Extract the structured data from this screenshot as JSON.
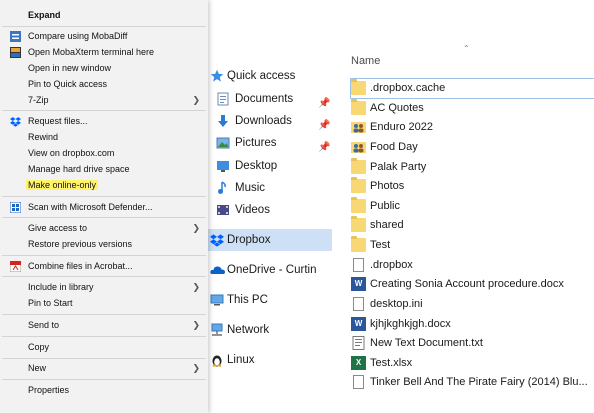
{
  "context_menu": {
    "items": [
      {
        "label": "Expand",
        "icon": "",
        "submenu": false
      },
      {
        "label": "Compare using MobaDiff",
        "icon": "mobadiff-icon",
        "submenu": false
      },
      {
        "label": "Open MobaXterm terminal here",
        "icon": "mobaxterm-icon",
        "submenu": false
      },
      {
        "label": "Open in new window",
        "icon": "",
        "submenu": false
      },
      {
        "label": "Pin to Quick access",
        "icon": "",
        "submenu": false
      },
      {
        "label": "7-Zip",
        "icon": "",
        "submenu": true
      },
      {
        "label": "Request files...",
        "icon": "dropbox-icon",
        "submenu": false
      },
      {
        "label": "Rewind",
        "icon": "",
        "submenu": false
      },
      {
        "label": "View on dropbox.com",
        "icon": "",
        "submenu": false
      },
      {
        "label": "Manage hard drive space",
        "icon": "",
        "submenu": false
      },
      {
        "label": "Make online-only",
        "icon": "",
        "submenu": false,
        "highlight_color": "#fff36b"
      },
      {
        "label": "Scan with Microsoft Defender...",
        "icon": "defender-icon",
        "submenu": false
      },
      {
        "label": "Give access to",
        "icon": "",
        "submenu": true
      },
      {
        "label": "Restore previous versions",
        "icon": "",
        "submenu": false
      },
      {
        "label": "Combine files in Acrobat...",
        "icon": "acrobat-icon",
        "submenu": false
      },
      {
        "label": "Include in library",
        "icon": "",
        "submenu": true
      },
      {
        "label": "Pin to Start",
        "icon": "",
        "submenu": false
      },
      {
        "label": "Send to",
        "icon": "",
        "submenu": true
      },
      {
        "label": "Copy",
        "icon": "",
        "submenu": false
      },
      {
        "label": "New",
        "icon": "",
        "submenu": true
      },
      {
        "label": "Properties",
        "icon": "",
        "submenu": false
      }
    ]
  },
  "nav_pane": {
    "items": [
      {
        "label": "Quick access",
        "icon": "star-icon",
        "pinned": false
      },
      {
        "label": "Documents",
        "icon": "documents-icon",
        "pinned": true
      },
      {
        "label": "Downloads",
        "icon": "downloads-icon",
        "pinned": true
      },
      {
        "label": "Pictures",
        "icon": "pictures-icon",
        "pinned": true
      },
      {
        "label": "Desktop",
        "icon": "desktop-icon",
        "pinned": false
      },
      {
        "label": "Music",
        "icon": "music-icon",
        "pinned": false
      },
      {
        "label": "Videos",
        "icon": "videos-icon",
        "pinned": false
      },
      {
        "label": "Dropbox",
        "icon": "dropbox-icon",
        "pinned": false,
        "selected": true
      },
      {
        "label": "OneDrive - Curtin",
        "icon": "onedrive-icon",
        "pinned": false
      },
      {
        "label": "This PC",
        "icon": "this-pc-icon",
        "pinned": false
      },
      {
        "label": "Network",
        "icon": "network-icon",
        "pinned": false
      },
      {
        "label": "Linux",
        "icon": "linux-icon",
        "pinned": false
      }
    ]
  },
  "file_list": {
    "column_header": "Name",
    "files": [
      {
        "name": ".dropbox.cache",
        "type": "folder",
        "selected": true
      },
      {
        "name": "AC Quotes",
        "type": "folder"
      },
      {
        "name": "Enduro 2022",
        "type": "shared-folder"
      },
      {
        "name": "Food Day",
        "type": "shared-folder"
      },
      {
        "name": "Palak Party",
        "type": "folder"
      },
      {
        "name": "Photos",
        "type": "folder"
      },
      {
        "name": "Public",
        "type": "folder"
      },
      {
        "name": "shared",
        "type": "folder"
      },
      {
        "name": "Test",
        "type": "folder"
      },
      {
        "name": ".dropbox",
        "type": "file"
      },
      {
        "name": "Creating Sonia Account procedure.docx",
        "type": "word"
      },
      {
        "name": "desktop.ini",
        "type": "file"
      },
      {
        "name": "kjhjkghkjgh.docx",
        "type": "word"
      },
      {
        "name": "New Text Document.txt",
        "type": "text"
      },
      {
        "name": "Test.xlsx",
        "type": "excel"
      },
      {
        "name": "Tinker Bell And The Pirate Fairy (2014) Blu...",
        "type": "file"
      }
    ]
  }
}
